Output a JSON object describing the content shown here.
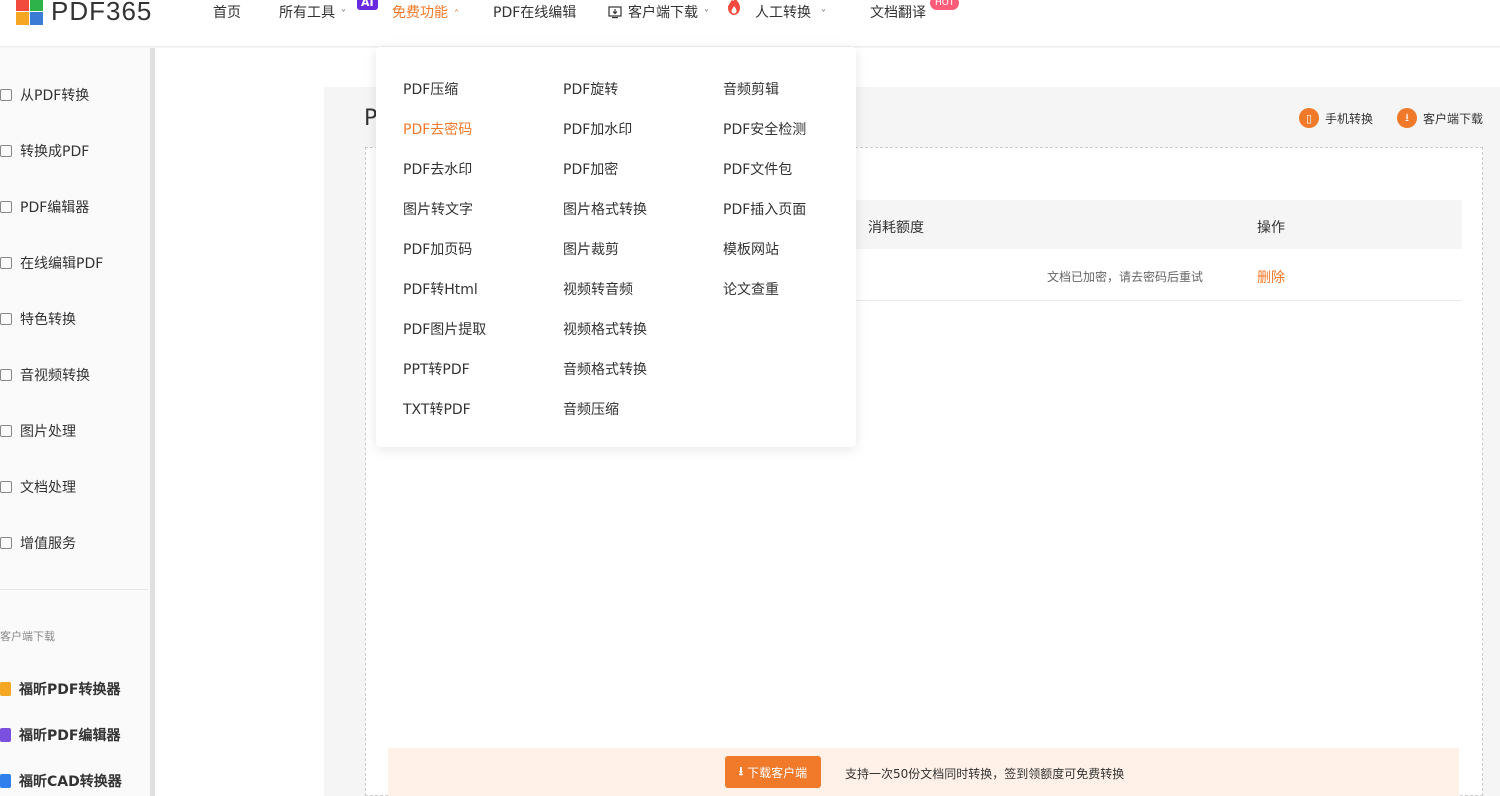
{
  "brand": {
    "logo_text": "PDF365",
    "logo_colors": [
      "#f24a3d",
      "#2db34a",
      "#3a7bd5",
      "#f5a623"
    ]
  },
  "nav": {
    "items": [
      {
        "label": "首页"
      },
      {
        "label": "所有工具"
      },
      {
        "label": "免费功能"
      },
      {
        "label": "PDF在线编辑"
      },
      {
        "label": "客户端下载"
      },
      {
        "label": "人工转换"
      },
      {
        "label": "文档翻译"
      }
    ],
    "badge_ai": "AI",
    "badge_hot": "HOT",
    "chevron_down": "˅",
    "chevron_up": "˄"
  },
  "sidebar": {
    "items": [
      {
        "label": "从PDF转换",
        "icon": "convert-from-pdf-icon"
      },
      {
        "label": "转换成PDF",
        "icon": "convert-to-pdf-icon"
      },
      {
        "label": "PDF编辑器",
        "icon": "pdf-editor-icon"
      },
      {
        "label": "在线编辑PDF",
        "icon": "online-edit-icon"
      },
      {
        "label": "特色转换",
        "icon": "star-icon"
      },
      {
        "label": "音视频转换",
        "icon": "media-icon"
      },
      {
        "label": "图片处理",
        "icon": "image-icon"
      },
      {
        "label": "文档处理",
        "icon": "document-icon"
      },
      {
        "label": "增值服务",
        "icon": "service-icon"
      }
    ],
    "caption": "客户端下载",
    "apps": [
      {
        "label": "福昕PDF转换器",
        "color": "#f5a623"
      },
      {
        "label": "福昕PDF编辑器",
        "color": "#7b4fe0"
      },
      {
        "label": "福昕CAD转换器",
        "color": "#2f80ed"
      }
    ]
  },
  "main": {
    "title_partial": "P",
    "mobile_link": "手机转换",
    "client_link": "客户端下载",
    "table": {
      "headers": [
        "消耗额度",
        "操作"
      ],
      "rows": [
        {
          "message": "文档已加密，请去密码后重试",
          "action": "删除"
        }
      ]
    },
    "download_button": "下载客户端",
    "tip": "支持一次50份文档同时转换，签到领额度可免费转换"
  },
  "dropdown": {
    "columns": [
      [
        "PDF压缩",
        "PDF去密码",
        "PDF去水印",
        "图片转文字",
        "PDF加页码",
        "PDF转Html",
        "PDF图片提取",
        "PPT转PDF",
        "TXT转PDF"
      ],
      [
        "PDF旋转",
        "PDF加水印",
        "PDF加密",
        "图片格式转换",
        "图片裁剪",
        "视频转音频",
        "视频格式转换",
        "音频格式转换",
        "音频压缩"
      ],
      [
        "音频剪辑",
        "PDF安全检测",
        "PDF文件包",
        "PDF插入页面",
        "模板网站",
        "论文查重"
      ]
    ],
    "highlighted": "PDF去密码"
  },
  "colors": {
    "accent": "#f0792a",
    "ai_badge": "#6a2be0",
    "hot_badge": "#ff5c7a"
  }
}
